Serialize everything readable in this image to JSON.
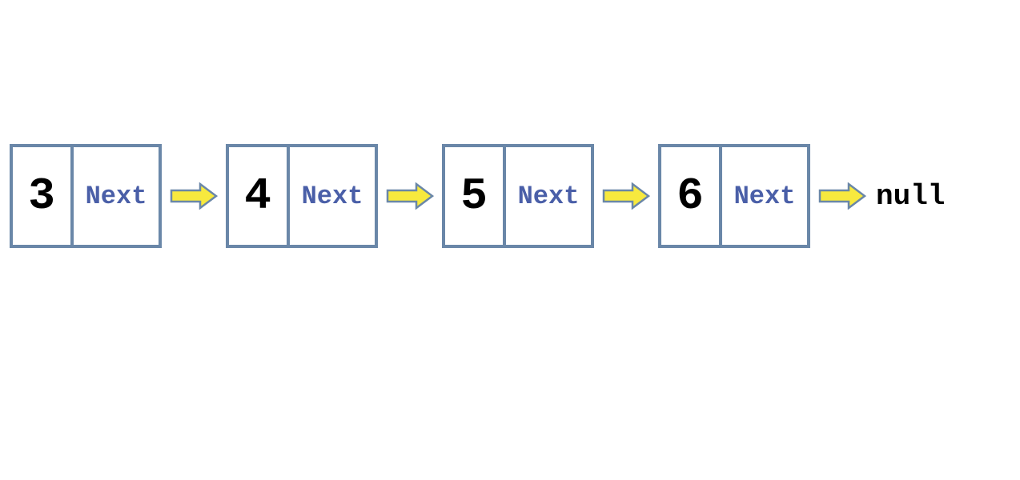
{
  "diagram": {
    "type": "linked-list",
    "next_label": "Next",
    "terminal_label": "null",
    "nodes": [
      {
        "value": "3",
        "next": "Next"
      },
      {
        "value": "4",
        "next": "Next"
      },
      {
        "value": "5",
        "next": "Next"
      },
      {
        "value": "6",
        "next": "Next"
      }
    ],
    "colors": {
      "border": "#6a87a8",
      "value_text": "#000000",
      "next_text": "#4a5fa8",
      "arrow_fill": "#f7e93e",
      "arrow_stroke": "#6a87a8"
    }
  }
}
